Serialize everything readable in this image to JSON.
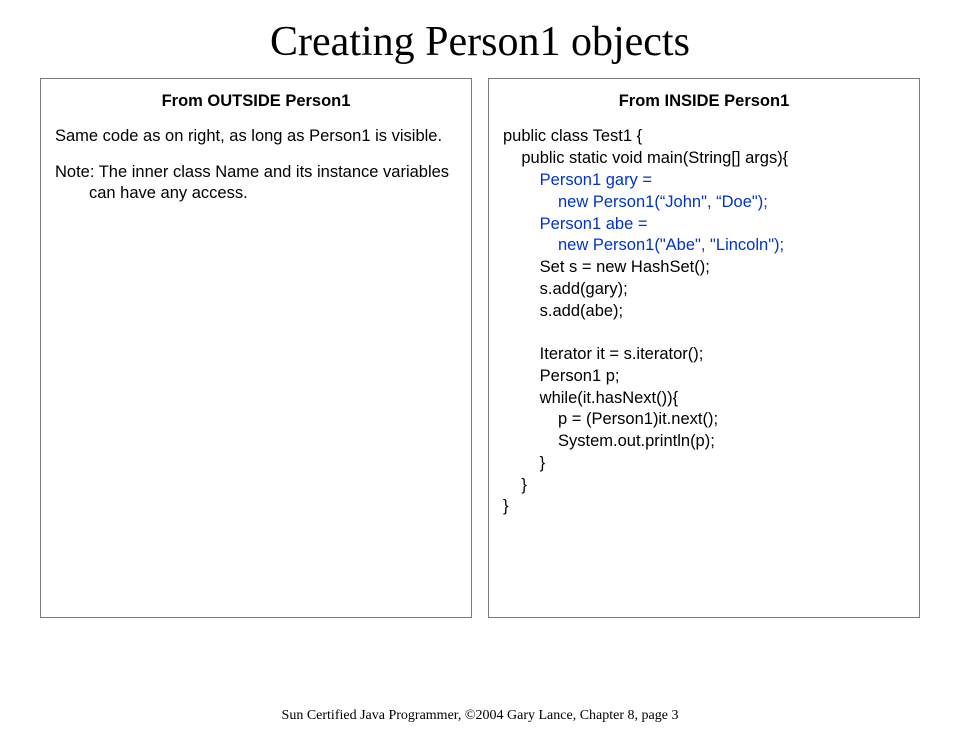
{
  "title": "Creating Person1 objects",
  "left": {
    "heading": "From OUTSIDE Person1",
    "p1": "Same code as on right, as long as Person1 is visible.",
    "p2": "Note: The inner class Name and its instance variables can have any access."
  },
  "right": {
    "heading": "From INSIDE Person1",
    "c01": "public class Test1 {",
    "c02": "    public static void main(String[] args){",
    "c03": "        Person1 gary =",
    "c04": "            new Person1(“John\", “Doe\");",
    "c05": "        Person1 abe =",
    "c06": "            new Person1(\"Abe\", \"Lincoln\");",
    "c07": "        Set s = new HashSet();",
    "c08": "        s.add(gary);",
    "c09": "        s.add(abe);",
    "c10": "",
    "c11": "        Iterator it = s.iterator();",
    "c12": "        Person1 p;",
    "c13": "        while(it.hasNext()){",
    "c14": "            p = (Person1)it.next();",
    "c15": "            System.out.println(p);",
    "c16": "        }",
    "c17": "    }",
    "c18": "}"
  },
  "footer": "Sun Certified Java Programmer, ©2004 Gary Lance, Chapter 8, page 3"
}
